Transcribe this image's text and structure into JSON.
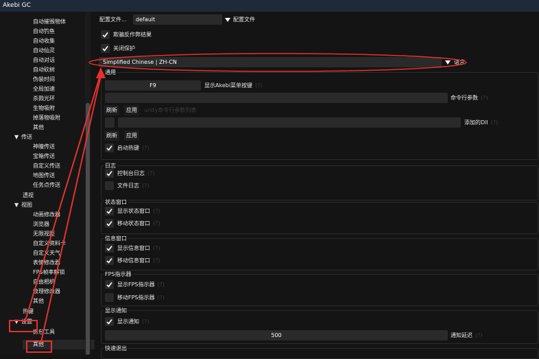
{
  "window": {
    "title": "Akebi GC"
  },
  "sidebar": {
    "items": [
      {
        "label": "自动摧毁物体",
        "expanded": null
      },
      {
        "label": "自动钓鱼",
        "expanded": null
      },
      {
        "label": "自动收集",
        "expanded": null
      },
      {
        "label": "自动仙灵",
        "expanded": null
      },
      {
        "label": "自动对话",
        "expanded": null
      },
      {
        "label": "自动砍树",
        "expanded": null
      },
      {
        "label": "伪装时间",
        "expanded": null
      },
      {
        "label": "全局加速",
        "expanded": null
      },
      {
        "label": "杀戮光环",
        "expanded": null
      },
      {
        "label": "生物吸附",
        "expanded": null
      },
      {
        "label": "掉落物吸附",
        "expanded": null
      },
      {
        "label": "其他",
        "expanded": null
      },
      {
        "label": "传送",
        "expanded": true
      },
      {
        "label": "神瞳传送",
        "expanded": null
      },
      {
        "label": "宝箱传送",
        "expanded": null
      },
      {
        "label": "自定义传送",
        "expanded": null
      },
      {
        "label": "地图传送",
        "expanded": null
      },
      {
        "label": "任务点传送",
        "expanded": null
      },
      {
        "label": "透视",
        "expanded": null
      },
      {
        "label": "视图",
        "expanded": true
      },
      {
        "label": "动画修改器",
        "expanded": null
      },
      {
        "label": "浏览器",
        "expanded": null
      },
      {
        "label": "无限视距",
        "expanded": null
      },
      {
        "label": "自定义资料卡",
        "expanded": null
      },
      {
        "label": "自定义天气",
        "expanded": null
      },
      {
        "label": "表情修改器",
        "expanded": null
      },
      {
        "label": "FPS帧率解锁",
        "expanded": null
      },
      {
        "label": "自由相机",
        "expanded": null
      },
      {
        "label": "纹理修改器",
        "expanded": null
      },
      {
        "label": "其他",
        "expanded": null
      },
      {
        "label": "热键",
        "expanded": null
      },
      {
        "label": "设置",
        "expanded": true
      },
      {
        "label": "抓包工具",
        "expanded": null
      },
      {
        "label": "其他",
        "expanded": null
      }
    ]
  },
  "profile": {
    "button_label": "配置文件...",
    "value": "default",
    "label": "配置文件"
  },
  "checks_top": [
    {
      "label": "欺骗反作弊结果",
      "checked": true
    },
    {
      "label": "关闭保护",
      "checked": true
    }
  ],
  "language": {
    "value": "Simplified Chinese | ZH-CN",
    "label": "语言"
  },
  "general": {
    "title": "通用",
    "hotkey_value": "F9",
    "hotkey_label": "显示Akebi菜单按键",
    "cmdline_label": "命令行参数",
    "refresh": "刷新",
    "apply": "应用",
    "unity_placeholder": "unity命令行参数列表",
    "dll_label": "添加的Dll",
    "refresh2": "刷新",
    "apply2": "应用",
    "hotkeys_label": "启动热键",
    "hotkeys_checked": true
  },
  "log": {
    "title": "日志",
    "items": [
      {
        "label": "控制台日志",
        "checked": true
      },
      {
        "label": "文件日志",
        "checked": false
      }
    ]
  },
  "status": {
    "title": "状态窗口",
    "items": [
      {
        "label": "显示状态窗口",
        "checked": true
      },
      {
        "label": "移动状态窗口",
        "checked": true
      }
    ]
  },
  "info": {
    "title": "信息窗口",
    "items": [
      {
        "label": "显示信息窗口",
        "checked": true
      },
      {
        "label": "移动信息窗口",
        "checked": true
      }
    ]
  },
  "fps": {
    "title": "FPS指示器",
    "items": [
      {
        "label": "显示FPS指示器",
        "checked": true
      },
      {
        "label": "移动FPS指示器",
        "checked": false
      }
    ]
  },
  "notify": {
    "title": "显示通知",
    "show_label": "显示通知",
    "show_checked": true,
    "delay_value": "500",
    "delay_label": "通知延迟"
  },
  "quick_exit": {
    "title": "快速退出"
  },
  "colors": {
    "annotation": "#e8312f",
    "background": "#141414",
    "field": "#2a2a2a",
    "titlebar": "#1f2a39"
  }
}
